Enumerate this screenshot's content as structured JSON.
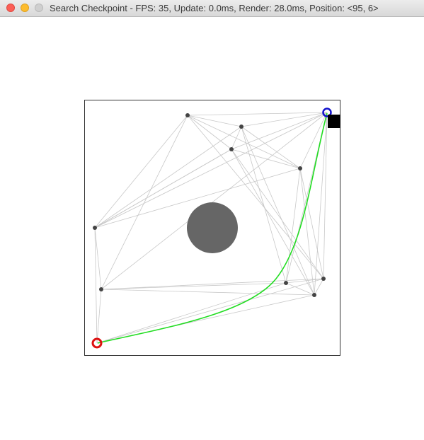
{
  "window": {
    "title": "Search Checkpoint  -  FPS: 35, Update: 0.0ms, Render: 28.0ms, Position: <95, 6>"
  },
  "colors": {
    "frame": "#333333",
    "edge": "#c8c8c8",
    "path": "#22dd22",
    "node": "#444444",
    "obstacle": "#666666",
    "start": "#dd1111",
    "goal": "#1111cc",
    "block": "#000000"
  },
  "icons": {
    "close": "close-icon",
    "minimize": "minimize-icon",
    "maximize": "maximize-icon"
  }
}
